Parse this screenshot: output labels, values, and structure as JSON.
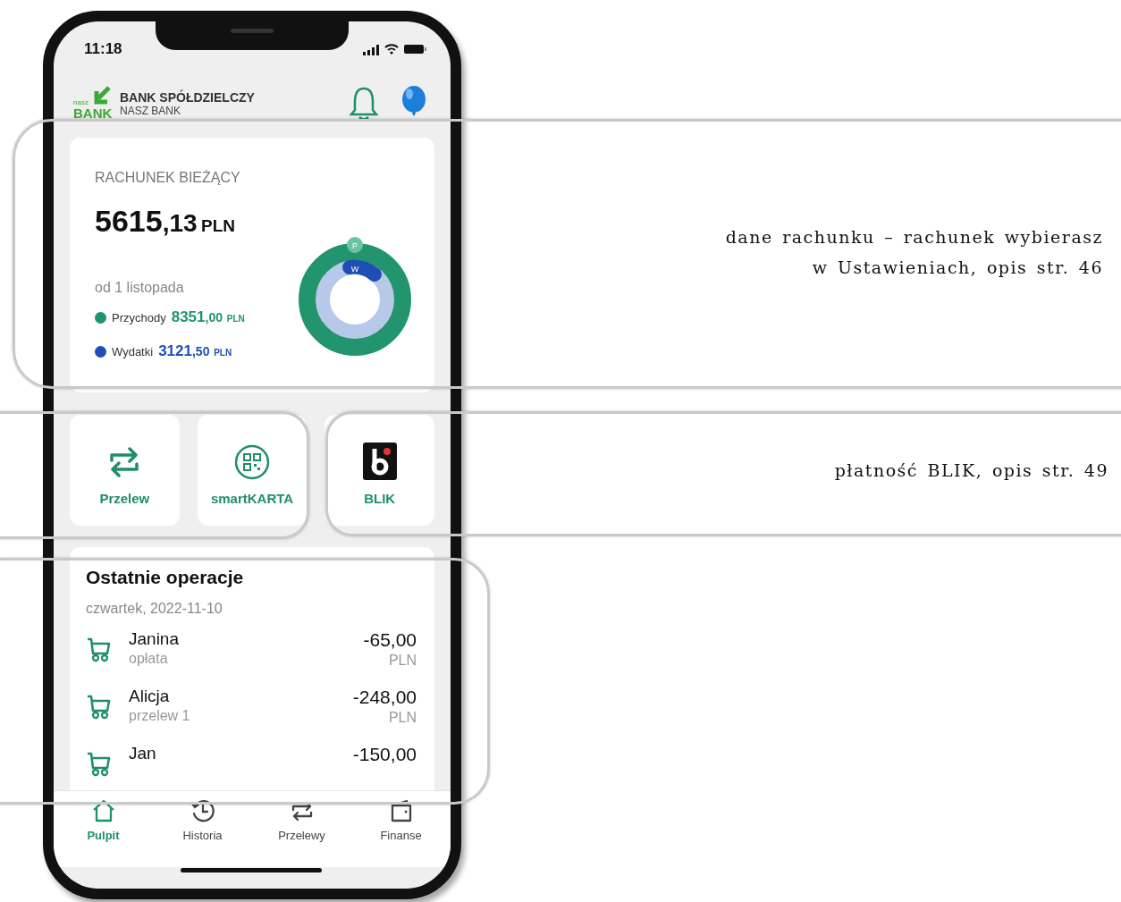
{
  "status_bar": {
    "time": "11:18"
  },
  "header": {
    "logo_small": "nasz",
    "logo_big": "BANK",
    "bank_name": "BANK SPÓŁDZIELCZY",
    "bank_subname": "NASZ BANK"
  },
  "account": {
    "title": "RACHUNEK BIEŻĄCY",
    "balance_main": "5615",
    "balance_decimal": ",13",
    "currency": "PLN",
    "period": "od 1 listopada",
    "legend": [
      {
        "label": "Przychody",
        "amount": "8351",
        "decimal": ",00",
        "currency": "PLN",
        "color": "#1f9470"
      },
      {
        "label": "Wydatki",
        "amount": "3121",
        "decimal": ",50",
        "currency": "PLN",
        "color": "#1f4fb5"
      }
    ],
    "donut_labels": [
      "P",
      "W"
    ]
  },
  "actions": [
    {
      "label": "Przelew",
      "kind": "transfer"
    },
    {
      "label": "smartKARTA",
      "kind": "qr"
    },
    {
      "label": "BLIK",
      "kind": "blik"
    }
  ],
  "operations": {
    "title": "Ostatnie operacje",
    "date": "czwartek, 2022-11-10",
    "items": [
      {
        "name": "Janina",
        "subtitle": "opłata",
        "amount": "-65,00",
        "currency": "PLN"
      },
      {
        "name": "Alicja",
        "subtitle": "przelew 1",
        "amount": "-248,00",
        "currency": "PLN"
      },
      {
        "name": "Jan",
        "amount": "-150,00"
      }
    ]
  },
  "nav": [
    {
      "label": "Pulpit",
      "kind": "home",
      "selected": true
    },
    {
      "label": "Historia",
      "kind": "history",
      "selected": false
    },
    {
      "label": "Przelewy",
      "kind": "transfer",
      "selected": false
    },
    {
      "label": "Finanse",
      "kind": "wallet",
      "selected": false
    }
  ],
  "annotations": [
    {
      "lines": [
        "dane rachunku – rachunek wybierasz",
        "w Ustawieniach, opis str. 46"
      ]
    },
    {
      "lines": [
        "płatność BLIK, opis str. 49"
      ]
    }
  ]
}
